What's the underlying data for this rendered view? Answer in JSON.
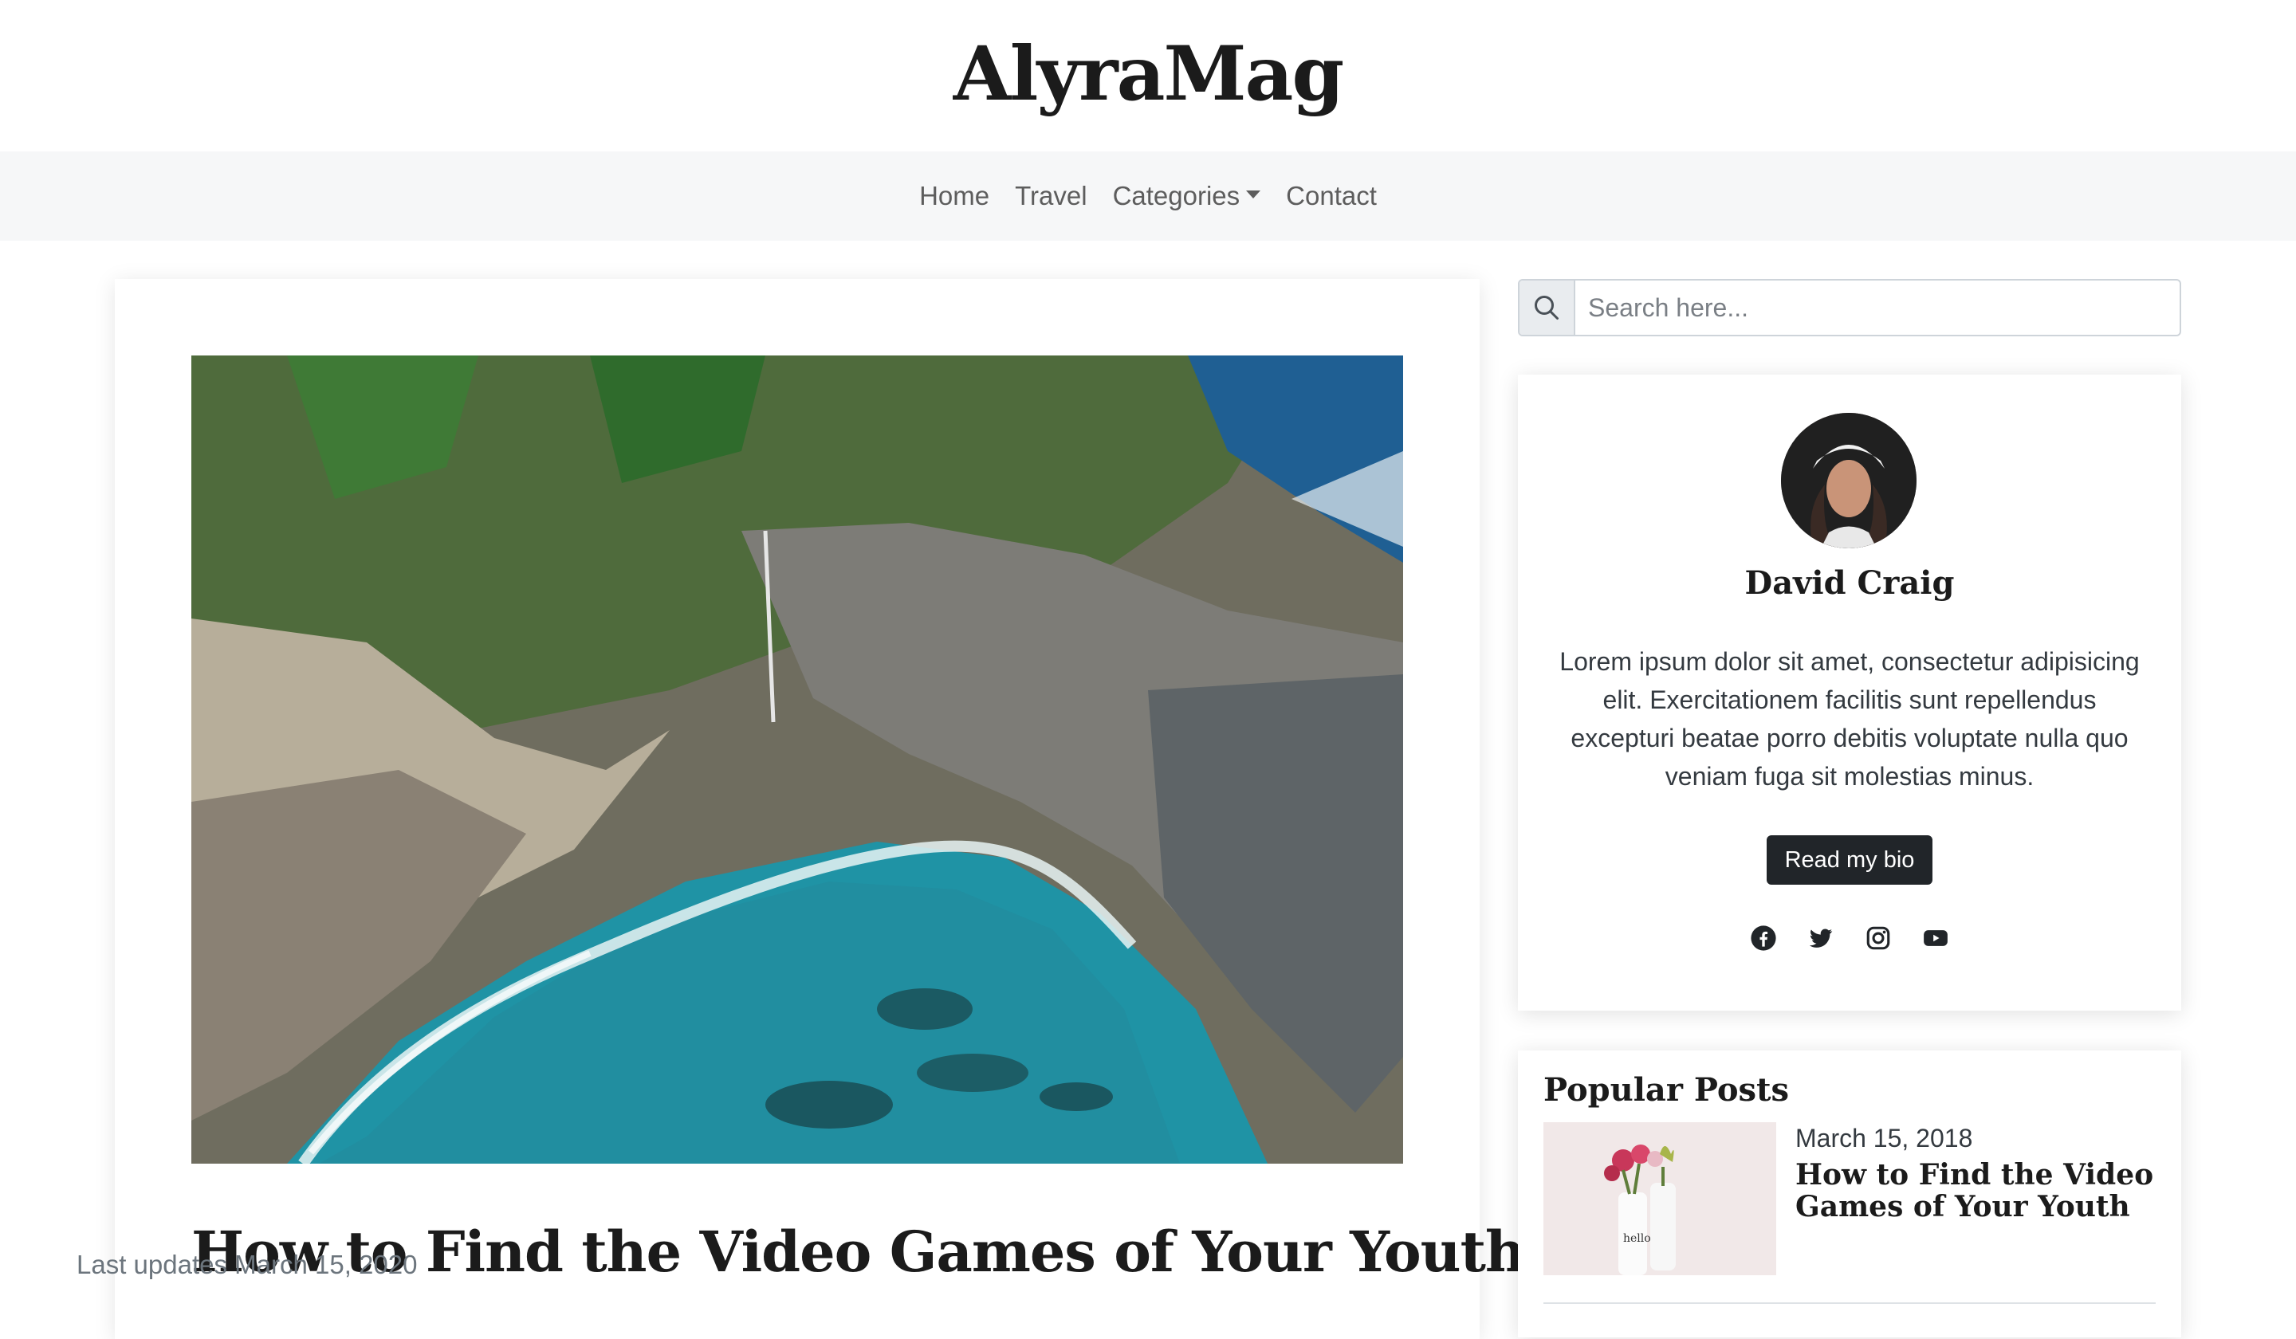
{
  "site": {
    "brand": "AlyraMag"
  },
  "nav": {
    "items": [
      "Home",
      "Travel",
      "Categories",
      "Contact"
    ]
  },
  "post": {
    "title": "How to Find the Video Games of Your Youth",
    "date": "Last updates March 15, 2020",
    "image": "aerial-coastline-photo"
  },
  "search": {
    "placeholder": "Search here...",
    "icon": "search-icon"
  },
  "bio": {
    "name": "David Craig",
    "text": "Lorem ipsum dolor sit amet, consectetur adipisicing elit. Exercitationem facilitis sunt repellendus excepturi beatae porro debitis voluptate nulla quo veniam fuga sit molestias minus.",
    "button": "Read my bio",
    "social": [
      "facebook-icon",
      "twitter-icon",
      "instagram-icon",
      "youtube-icon"
    ]
  },
  "popular": {
    "title": "Popular Posts",
    "posts": [
      {
        "date": "March 15, 2018",
        "title": "How to Find the Video Games of Your Youth"
      }
    ]
  },
  "colors": {
    "nav_bg": "#f6f7f8",
    "button_bg": "#212529",
    "text_dark": "#1b1b1b",
    "muted": "#6c757d"
  }
}
